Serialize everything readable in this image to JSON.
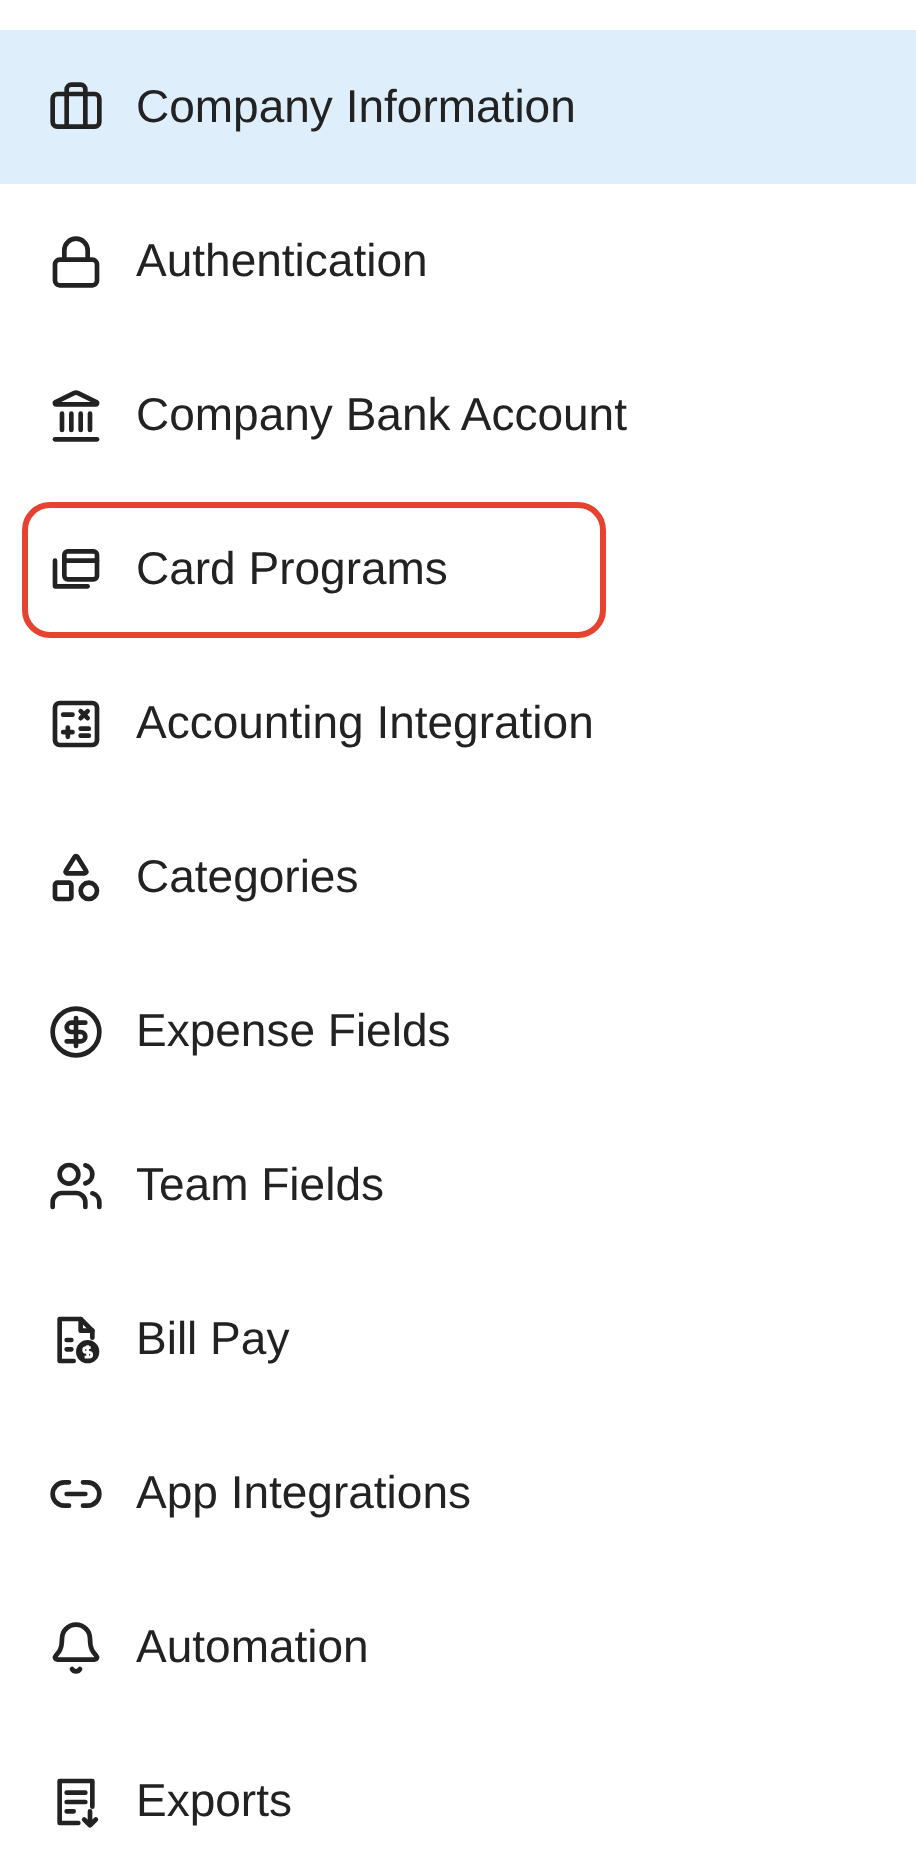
{
  "menu": [
    {
      "label": "Company Information",
      "selected": true,
      "outlined": false
    },
    {
      "label": "Authentication",
      "selected": false,
      "outlined": false
    },
    {
      "label": "Company Bank Account",
      "selected": false,
      "outlined": false
    },
    {
      "label": "Card Programs",
      "selected": false,
      "outlined": true
    },
    {
      "label": "Accounting Integration",
      "selected": false,
      "outlined": false
    },
    {
      "label": "Categories",
      "selected": false,
      "outlined": false
    },
    {
      "label": "Expense Fields",
      "selected": false,
      "outlined": false
    },
    {
      "label": "Team Fields",
      "selected": false,
      "outlined": false
    },
    {
      "label": "Bill Pay",
      "selected": false,
      "outlined": false
    },
    {
      "label": "App Integrations",
      "selected": false,
      "outlined": false
    },
    {
      "label": "Automation",
      "selected": false,
      "outlined": false
    },
    {
      "label": "Exports",
      "selected": false,
      "outlined": false
    }
  ]
}
